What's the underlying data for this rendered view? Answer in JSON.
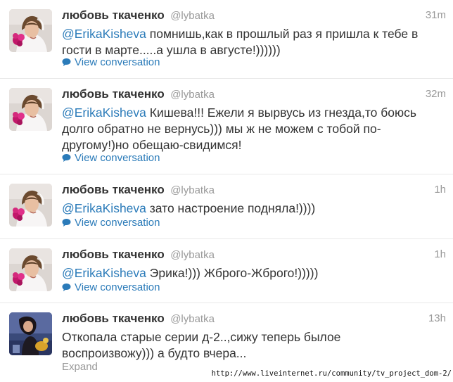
{
  "tweets": [
    {
      "name": "любовь ткаченко",
      "username": "@lybatka",
      "time": "31m",
      "mention": "@ErikaKisheva",
      "line1": " помнишь,как в прошлый раз я пришла к тебе в",
      "line2": "гости в марте.....а ушла в августе!))))))",
      "line3": "",
      "action": "View conversation",
      "avatar": "bride-avatar"
    },
    {
      "name": "любовь ткаченко",
      "username": "@lybatka",
      "time": "32m",
      "mention": "@ErikaKisheva",
      "line1": " Кишева!!! Ежели я вырвусь из гнезда,то боюсь",
      "line2": "долго обратно не вернусь))) мы ж не можем с тобой по-",
      "line3": "другому!)но обещаю-свидимся!",
      "action": "View conversation",
      "avatar": "bride-avatar"
    },
    {
      "name": "любовь ткаченко",
      "username": "@lybatka",
      "time": "1h",
      "mention": "@ErikaKisheva",
      "line1": " зато настроение подняла!))))",
      "line2": "",
      "line3": "",
      "action": "View conversation",
      "avatar": "bride-avatar"
    },
    {
      "name": "любовь ткаченко",
      "username": "@lybatka",
      "time": "1h",
      "mention": "@ErikaKisheva",
      "line1": " Эрика!))) Жброго-Жброго!)))))",
      "line2": "",
      "line3": "",
      "action": "View conversation",
      "avatar": "bride-avatar"
    },
    {
      "name": "любовь ткаченко",
      "username": "@lybatka",
      "time": "13h",
      "mention": "",
      "line1": "Откопала старые серии д-2..,сижу теперь былое",
      "line2": "воспроизвожу))) а будто вчера...",
      "line3": "",
      "action": "Expand",
      "avatar": "photo-avatar"
    }
  ],
  "watermark": "http://www.liveinternet.ru/community/tv_project_dom-2/",
  "colors": {
    "link": "#2b7bb9",
    "meta": "#999999",
    "text": "#333333",
    "divider": "#e8e8e8"
  }
}
